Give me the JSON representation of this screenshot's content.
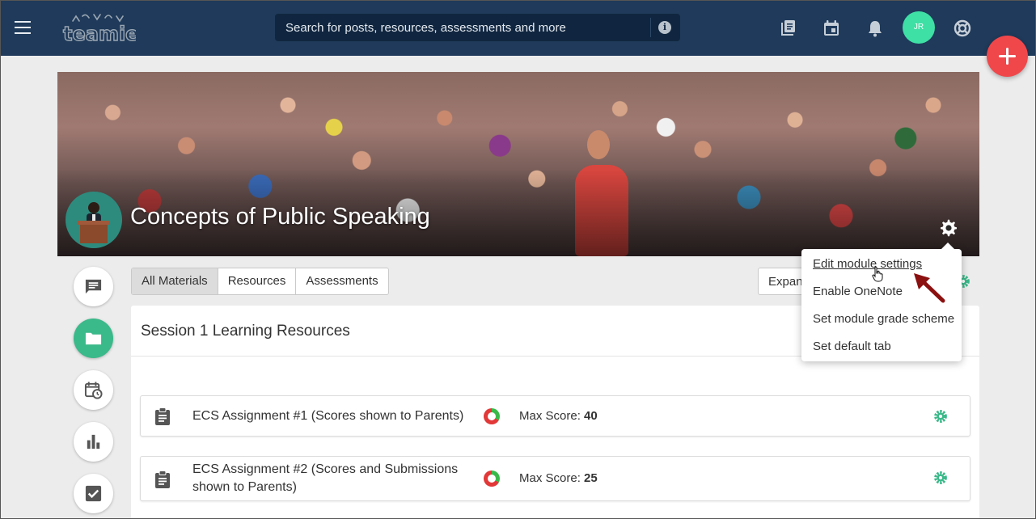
{
  "header": {
    "logo_text": "teamie",
    "search_placeholder": "Search for posts, resources, assessments and more",
    "avatar_initials": "JR"
  },
  "module": {
    "title": "Concepts of Public Speaking"
  },
  "tabs": [
    {
      "label": "All Materials",
      "active": true
    },
    {
      "label": "Resources",
      "active": false
    },
    {
      "label": "Assessments",
      "active": false
    }
  ],
  "toolbar": {
    "expand_label": "Expand"
  },
  "section": {
    "title": "Session 1 Learning Resources"
  },
  "items": [
    {
      "title": "ECS Assignment #1 (Scores shown to Parents)",
      "score_label": "Max Score:",
      "score_value": "40"
    },
    {
      "title": "ECS Assignment #2 (Scores and Submissions shown to Parents)",
      "score_label": "Max Score:",
      "score_value": "25"
    }
  ],
  "settings_menu": {
    "items": [
      {
        "label": "Edit module settings"
      },
      {
        "label": "Enable OneNote"
      },
      {
        "label": "Set module grade scheme"
      },
      {
        "label": "Set default tab"
      }
    ]
  },
  "colors": {
    "topbar": "#1f3a5a",
    "accent_green": "#3ab98a",
    "fab_red": "#f0474b",
    "avatar_green": "#3ee0a5",
    "annotation_arrow": "#8b1010"
  },
  "icons": {
    "rail": [
      "chat-icon",
      "folder-icon",
      "calendar-clock-icon",
      "bar-chart-icon",
      "checkbox-icon"
    ],
    "topbar": [
      "menu-icon",
      "notebook-icon",
      "calendar-icon",
      "bell-icon",
      "help-icon"
    ]
  }
}
